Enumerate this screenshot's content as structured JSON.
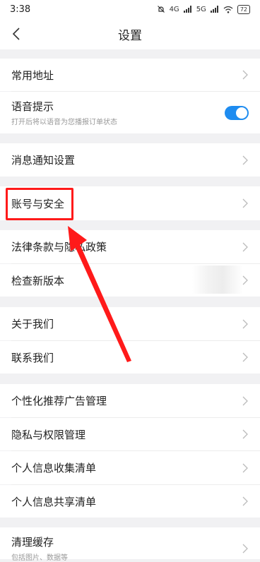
{
  "status": {
    "time": "3:38",
    "net1": "4G",
    "net2": "5G",
    "battery": "72"
  },
  "header": {
    "title": "设置"
  },
  "rows": [
    {
      "label": "常用地址"
    },
    {
      "label": "语音提示",
      "sub": "打开后将以语音为您播报订单状态",
      "toggle": true
    },
    {
      "label": "消息通知设置"
    },
    {
      "label": "账号与安全"
    },
    {
      "label": "法律条款与隐私政策"
    },
    {
      "label": "检查新版本"
    },
    {
      "label": "关于我们"
    },
    {
      "label": "联系我们"
    },
    {
      "label": "个性化推荐广告管理"
    },
    {
      "label": "隐私与权限管理"
    },
    {
      "label": "个人信息收集清单"
    },
    {
      "label": "个人信息共享清单"
    },
    {
      "label": "清理缓存",
      "sub": "包括图片、数据等"
    }
  ],
  "colors": {
    "accent": "#1e8cf0",
    "annotation": "#ff1a1a"
  }
}
